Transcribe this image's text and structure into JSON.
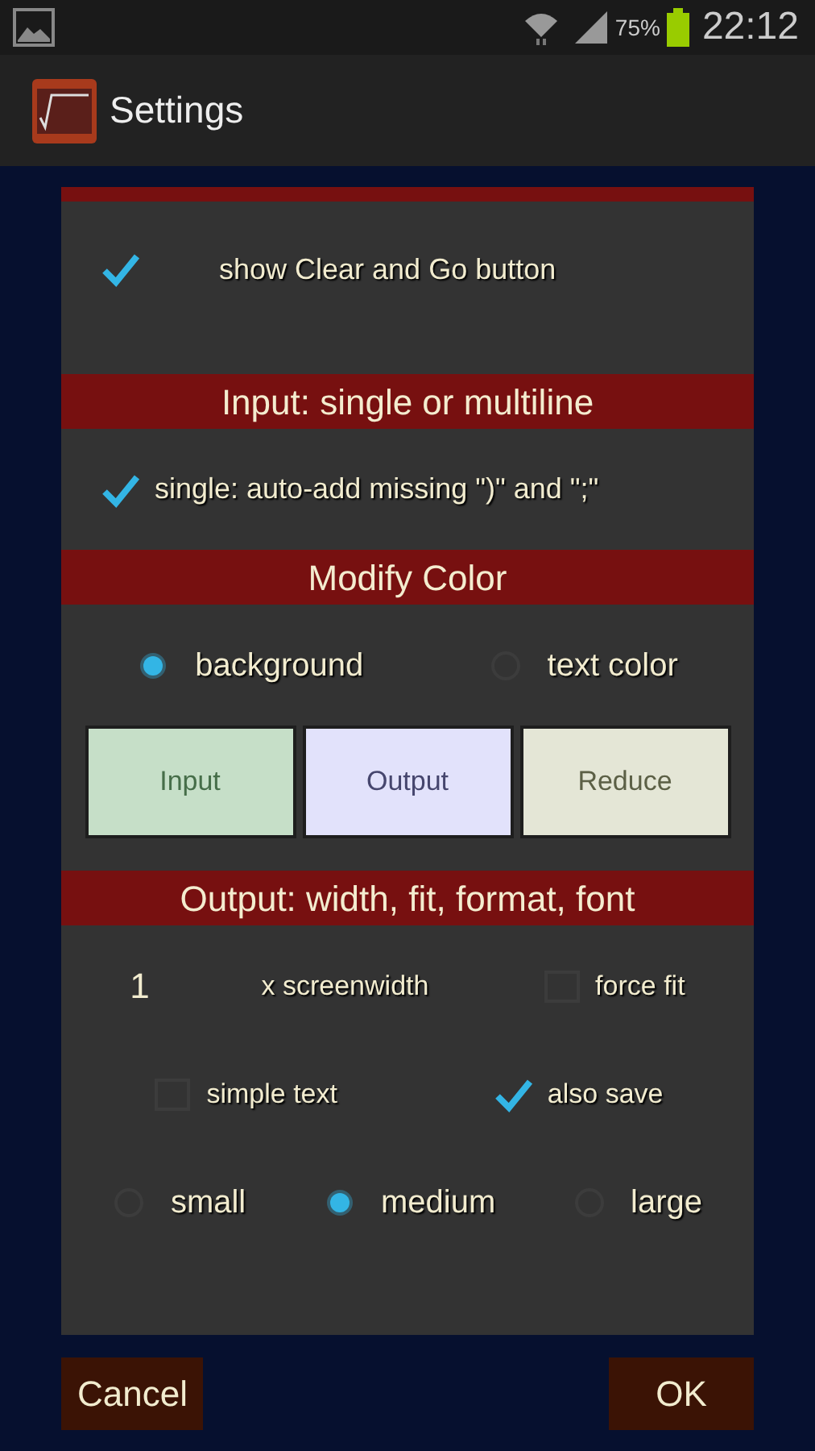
{
  "status_bar": {
    "battery": "75%",
    "time": "22:12"
  },
  "action_bar": {
    "title": "Settings"
  },
  "sections": [
    {
      "lines": [
        {
          "controls": [
            {
              "kind": "checkbox",
              "label": "show Clear and Go button",
              "checked": true
            }
          ]
        }
      ]
    },
    {
      "title": "Input: single or multiline",
      "lines": [
        {
          "controls": [
            {
              "kind": "checkbox",
              "label": "single: auto-add missing \")\" and \";\"",
              "checked": true
            }
          ]
        }
      ]
    },
    {
      "title": "Modify Color",
      "lines": [
        {
          "controls": [
            {
              "kind": "radio",
              "label": "background",
              "selected": true
            },
            {
              "kind": "radio",
              "label": "text color",
              "selected": false
            }
          ]
        },
        {
          "controls": [
            {
              "kind": "swatch",
              "label": "Input",
              "color": "#c6dfc8"
            },
            {
              "kind": "swatch",
              "label": "Output",
              "color": "#e2e2fb"
            },
            {
              "kind": "swatch",
              "label": "Reduce",
              "color": "#e4e6d6"
            }
          ]
        }
      ]
    },
    {
      "title": "Output: width, fit, format, font",
      "lines": [
        {
          "controls": [
            {
              "kind": "number",
              "value": "1"
            },
            {
              "kind": "text",
              "label": "x screenwidth"
            },
            {
              "kind": "checkbox",
              "label": "force fit",
              "checked": false
            }
          ]
        },
        {
          "controls": [
            {
              "kind": "checkbox",
              "label": "simple text",
              "checked": false
            },
            {
              "kind": "checkbox",
              "label": "also save",
              "checked": true
            }
          ]
        },
        {
          "controls": [
            {
              "kind": "radio",
              "label": "small",
              "selected": false
            },
            {
              "kind": "radio",
              "label": "medium",
              "selected": true
            },
            {
              "kind": "radio",
              "label": "large",
              "selected": false
            }
          ]
        }
      ]
    }
  ],
  "buttons": [
    {
      "label": "Cancel"
    },
    {
      "label": "OK"
    }
  ]
}
